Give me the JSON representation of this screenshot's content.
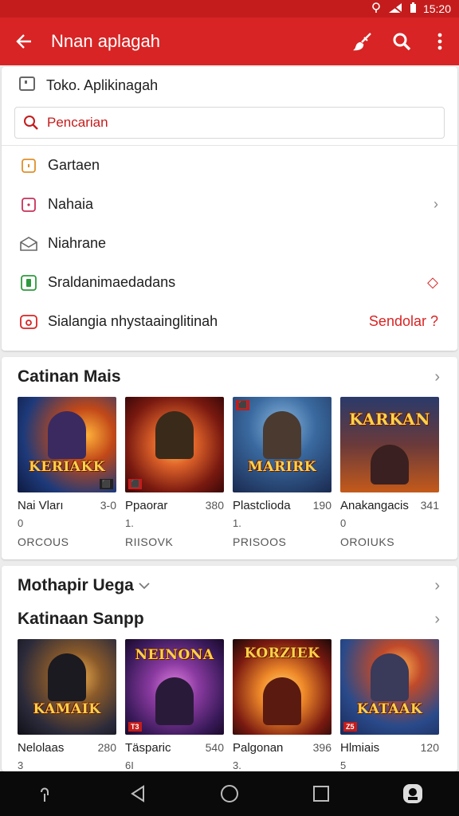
{
  "status_bar": {
    "time": "15:20",
    "icons": [
      "location-icon",
      "signal-icon",
      "battery-icon"
    ]
  },
  "app_bar": {
    "title": "Nnan aplagah",
    "actions": [
      "brush-icon",
      "search-icon",
      "more-vert-icon"
    ]
  },
  "colors": {
    "primary": "#d82424",
    "status": "#c41c1c",
    "accent_text": "#d82424"
  },
  "store_line": {
    "label": "Toko. Aplikinagah"
  },
  "search": {
    "placeholder": "Pencarian"
  },
  "menu": {
    "items": [
      {
        "label": "Gartaen",
        "icon": "square-orange-icon",
        "trail": ""
      },
      {
        "label": "Nahaia",
        "icon": "message-box-icon",
        "trail": "›"
      },
      {
        "label": "Niahrane",
        "icon": "envelope-open-icon",
        "trail": ""
      },
      {
        "label": "Sraldanimaedadans",
        "icon": "phone-green-icon",
        "trail": "◇"
      },
      {
        "label": "Sialangia nhystaainglitinah",
        "icon": "photo-red-icon",
        "trail": "Sendolar ?"
      }
    ]
  },
  "section1": {
    "title": "Catinan Mais",
    "apps": [
      {
        "name": "Nai Vları",
        "num": "3-0",
        "line2": "0",
        "line3": "ORCOUS",
        "logo": "KERIAKK",
        "tag": "⬛"
      },
      {
        "name": "Ppaorar",
        "num": "380",
        "line2": "1.",
        "line3": "RIISOVK",
        "logo": "",
        "tag": "⬛"
      },
      {
        "name": "Plastclioda",
        "num": "190",
        "line2": "1.",
        "line3": "PRISOOS",
        "logo": "MARIRK",
        "tag": "⬛"
      },
      {
        "name": "Anakangacis",
        "num": "341",
        "line2": "0",
        "line3": "OROIUKS",
        "logo": "KARKAN",
        "tag": ""
      }
    ]
  },
  "section2": {
    "title": "Mothapir Uega",
    "subtitle": "Katinaan Sanpp",
    "apps": [
      {
        "name": "Nelolaas",
        "num": "280",
        "line2": "3",
        "logo": "KAMAIK",
        "tag": ""
      },
      {
        "name": "Täsparic",
        "num": "540",
        "line2": "6I",
        "logo": "NEINONA",
        "tag": "T3"
      },
      {
        "name": "Palgonan",
        "num": "396",
        "line2": "3.",
        "logo": "KORZIEK",
        "tag": ""
      },
      {
        "name": "Hlmiais",
        "num": "120",
        "line2": "5",
        "logo": "KATAAK",
        "tag": "Z5"
      }
    ]
  }
}
